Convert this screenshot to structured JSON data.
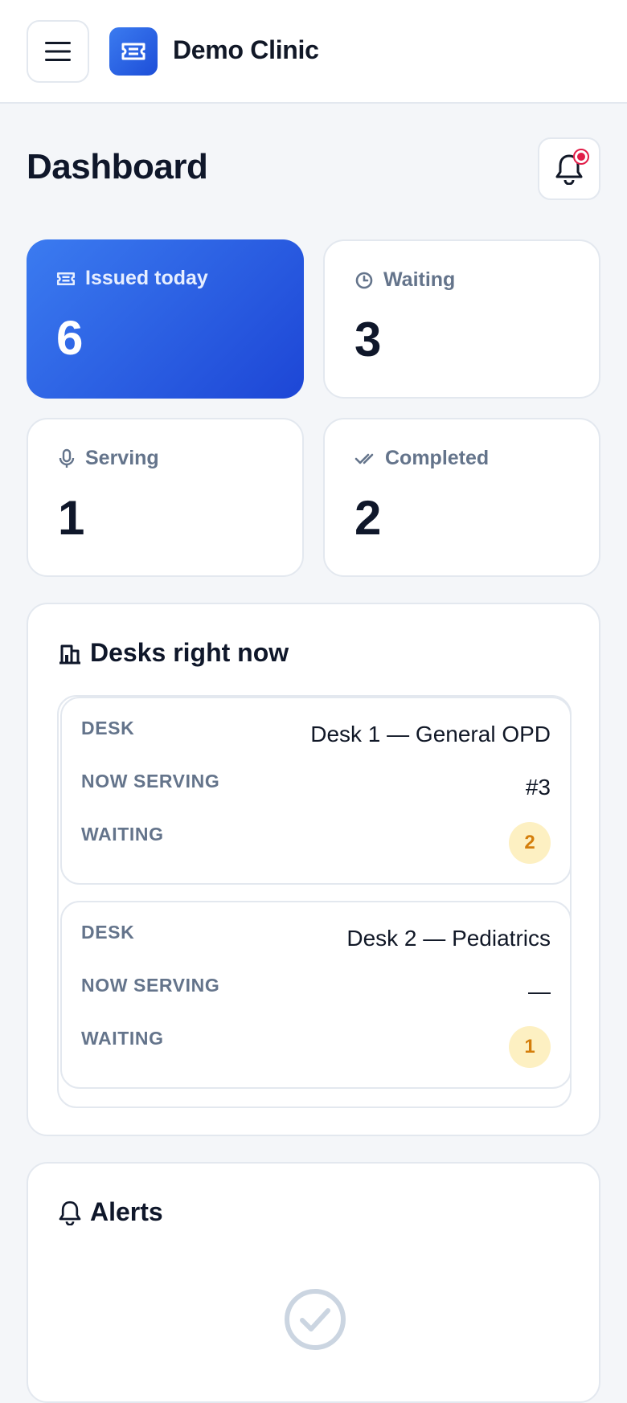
{
  "header": {
    "brand": "Demo Clinic",
    "menu_icon": "menu-icon",
    "logo_icon": "ticket-icon",
    "accent": "#2563eb"
  },
  "page": {
    "title": "Dashboard",
    "bell_icon": "bell-icon",
    "has_unread": true
  },
  "stats": [
    {
      "label": "Issued today",
      "value": "6",
      "icon": "ticket-icon",
      "primary": true
    },
    {
      "label": "Waiting",
      "value": "3",
      "icon": "clock-icon"
    },
    {
      "label": "Serving",
      "value": "1",
      "icon": "mic-icon"
    },
    {
      "label": "Completed",
      "value": "2",
      "icon": "double-check-icon"
    }
  ],
  "desks": {
    "title": "Desks right now",
    "icon": "building-icon",
    "labels": {
      "desk": "DESK",
      "now_serving": "NOW SERVING",
      "waiting": "WAITING"
    },
    "items": [
      {
        "desk": "Desk 1 — General OPD",
        "now_serving": "#3",
        "waiting": "2"
      },
      {
        "desk": "Desk 2 — Pediatrics",
        "now_serving": "—",
        "waiting": "1"
      }
    ]
  },
  "alerts": {
    "title": "Alerts",
    "icon": "bell-icon",
    "empty_icon": "check-circle-icon"
  }
}
